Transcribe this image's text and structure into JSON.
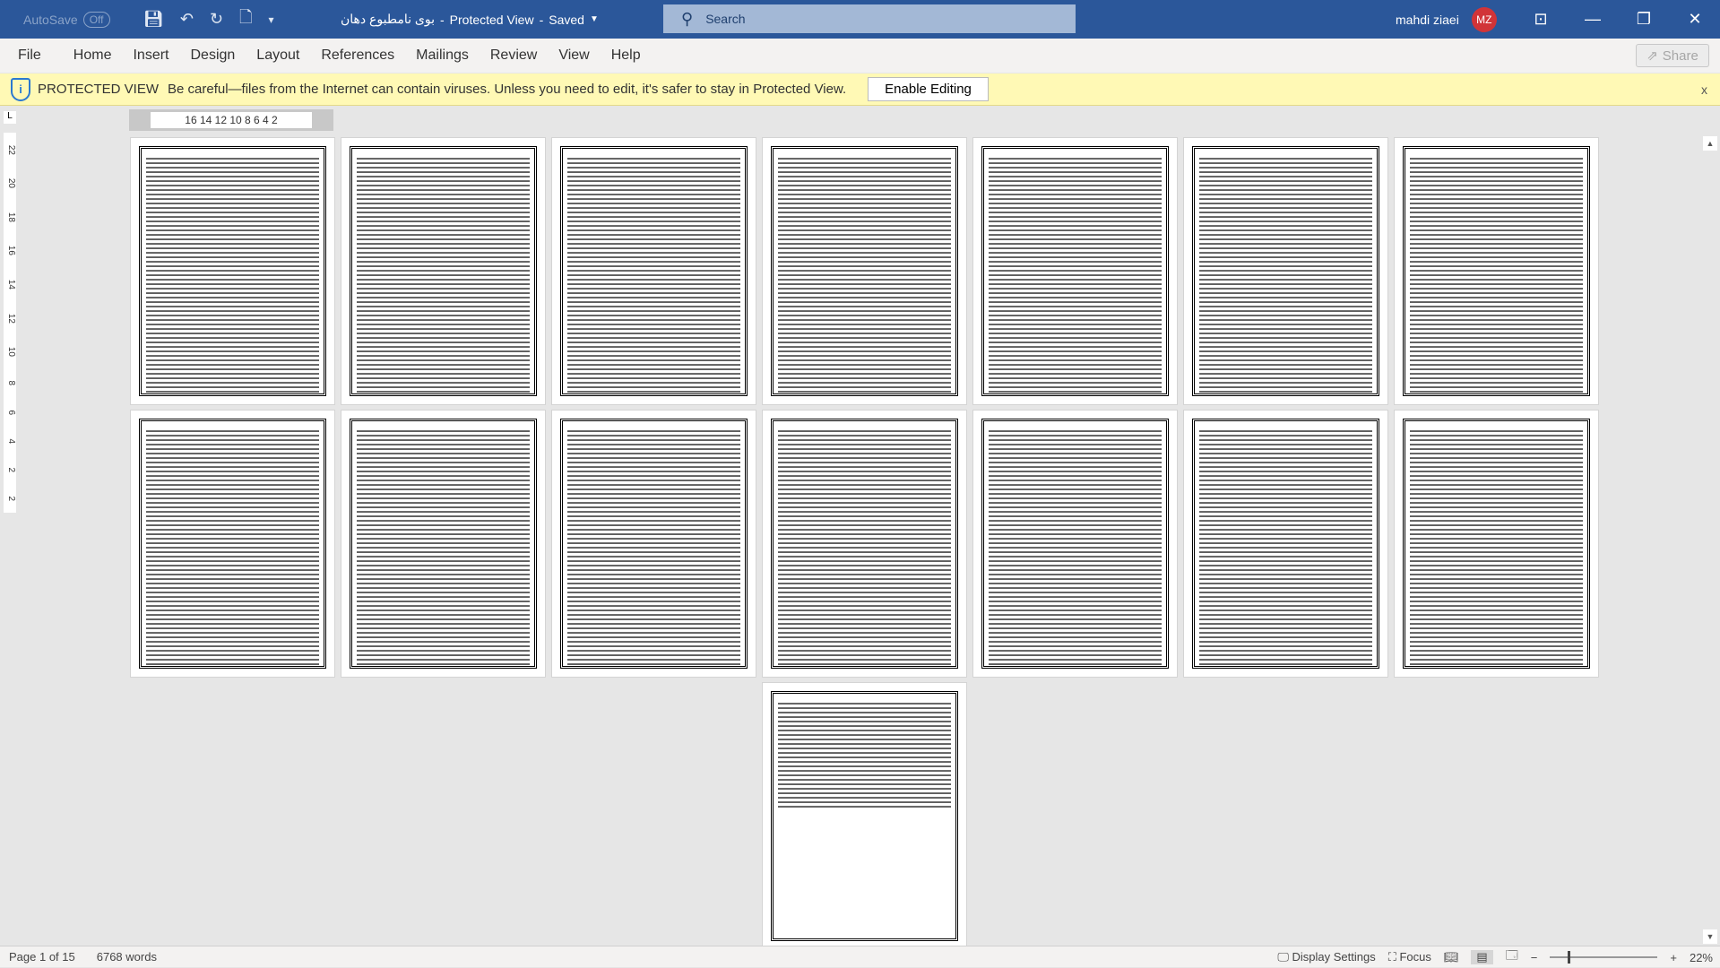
{
  "titlebar": {
    "autosave": "AutoSave",
    "autosave_state": "Off",
    "doc_title": "بوی نامطبوع دهان",
    "mode": "Protected View",
    "saved": "Saved",
    "search_placeholder": "Search",
    "user": "mahdi ziaei",
    "initials": "MZ"
  },
  "ribbon": {
    "tabs": [
      "File",
      "Home",
      "Insert",
      "Design",
      "Layout",
      "References",
      "Mailings",
      "Review",
      "View",
      "Help"
    ],
    "share": "Share"
  },
  "protected_view": {
    "title": "PROTECTED VIEW",
    "message": "Be careful—files from the Internet can contain viruses. Unless you need to edit, it's safer to stay in Protected View.",
    "enable": "Enable Editing",
    "close": "x"
  },
  "ruler": {
    "h_ticks": "16 14 12 10 8 6 4 2",
    "v_ticks": [
      "2",
      "2",
      "4",
      "6",
      "8",
      "10",
      "12",
      "14",
      "16",
      "18",
      "20",
      "22"
    ]
  },
  "document": {
    "page_count": 15,
    "last_page_fill": 0.45
  },
  "status": {
    "page": "Page 1 of 15",
    "words": "6768 words",
    "display_settings": "Display Settings",
    "focus": "Focus",
    "zoom": "22%"
  }
}
